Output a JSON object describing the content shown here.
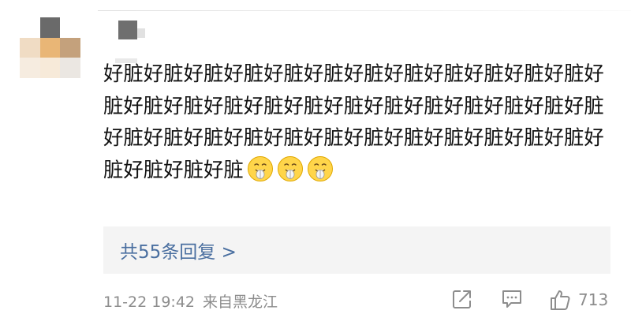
{
  "comment": {
    "text": "好脏好脏好脏好脏好脏好脏好脏好脏好脏好脏好脏好脏好脏好脏好脏好脏好脏好脏好脏好脏好脏好脏好脏好脏好脏好脏好脏好脏好脏好脏好脏好脏好脏好脏好脏好脏好脏好脏好脏好脏好脏",
    "emoji_name": "tongue-grin-emoji",
    "emoji_count": 3
  },
  "replies": {
    "label": "共55条回复 >"
  },
  "meta": {
    "timestamp": "11-22 19:42",
    "location": "来自黑龙江"
  },
  "actions": {
    "share_icon": "share-icon",
    "reply_icon": "comment-icon",
    "like_icon": "thumbs-up-icon",
    "like_count": "713"
  },
  "colors": {
    "link": "#4a6fa0",
    "meta": "#8d8d8d",
    "reply_bg": "#f4f4f4"
  }
}
